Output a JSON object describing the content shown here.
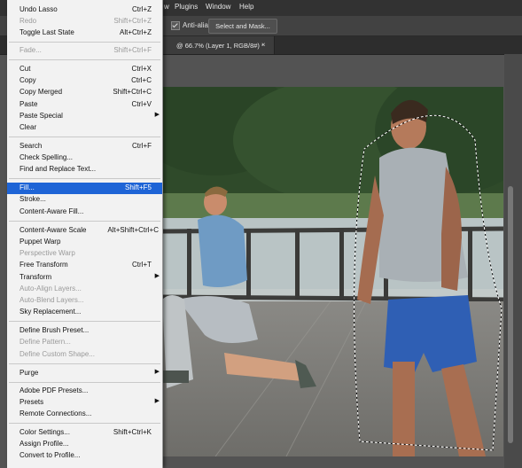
{
  "menubar": {
    "items": [
      {
        "label": "w"
      },
      {
        "label": "Plugins"
      },
      {
        "label": "Window"
      },
      {
        "label": "Help"
      }
    ]
  },
  "options": {
    "antialias_label": "Anti-alias",
    "select_mask_label": "Select and Mask..."
  },
  "tab": {
    "title": "@ 66.7% (Layer 1, RGB/8#) *",
    "close": "×"
  },
  "edit_menu": {
    "items": [
      {
        "label": "Undo Lasso",
        "shortcut": "Ctrl+Z"
      },
      {
        "label": "Redo",
        "shortcut": "Shift+Ctrl+Z"
      },
      {
        "label": "Toggle Last State",
        "shortcut": "Alt+Ctrl+Z"
      },
      {
        "label": "Fade...",
        "shortcut": "Shift+Ctrl+F"
      },
      {
        "label": "Cut",
        "shortcut": "Ctrl+X"
      },
      {
        "label": "Copy",
        "shortcut": "Ctrl+C"
      },
      {
        "label": "Copy Merged",
        "shortcut": "Shift+Ctrl+C"
      },
      {
        "label": "Paste",
        "shortcut": "Ctrl+V"
      },
      {
        "label": "Paste Special",
        "shortcut": ""
      },
      {
        "label": "Clear",
        "shortcut": ""
      },
      {
        "label": "Search",
        "shortcut": "Ctrl+F"
      },
      {
        "label": "Check Spelling...",
        "shortcut": ""
      },
      {
        "label": "Find and Replace Text...",
        "shortcut": ""
      },
      {
        "label": "Fill...",
        "shortcut": "Shift+F5"
      },
      {
        "label": "Stroke...",
        "shortcut": ""
      },
      {
        "label": "Content-Aware Fill...",
        "shortcut": ""
      },
      {
        "label": "Content-Aware Scale",
        "shortcut": "Alt+Shift+Ctrl+C"
      },
      {
        "label": "Puppet Warp",
        "shortcut": ""
      },
      {
        "label": "Perspective Warp",
        "shortcut": ""
      },
      {
        "label": "Free Transform",
        "shortcut": "Ctrl+T"
      },
      {
        "label": "Transform",
        "shortcut": ""
      },
      {
        "label": "Auto-Align Layers...",
        "shortcut": ""
      },
      {
        "label": "Auto-Blend Layers...",
        "shortcut": ""
      },
      {
        "label": "Sky Replacement...",
        "shortcut": ""
      },
      {
        "label": "Define Brush Preset...",
        "shortcut": ""
      },
      {
        "label": "Define Pattern...",
        "shortcut": ""
      },
      {
        "label": "Define Custom Shape...",
        "shortcut": ""
      },
      {
        "label": "Purge",
        "shortcut": ""
      },
      {
        "label": "Adobe PDF Presets...",
        "shortcut": ""
      },
      {
        "label": "Presets",
        "shortcut": ""
      },
      {
        "label": "Remote Connections...",
        "shortcut": ""
      },
      {
        "label": "Color Settings...",
        "shortcut": "Shift+Ctrl+K"
      },
      {
        "label": "Assign Profile...",
        "shortcut": ""
      },
      {
        "label": "Convert to Profile...",
        "shortcut": ""
      }
    ]
  },
  "colors": {
    "highlight": "#1e64d6",
    "menu_bg": "#f2f2f2",
    "app_bg": "#535353"
  }
}
